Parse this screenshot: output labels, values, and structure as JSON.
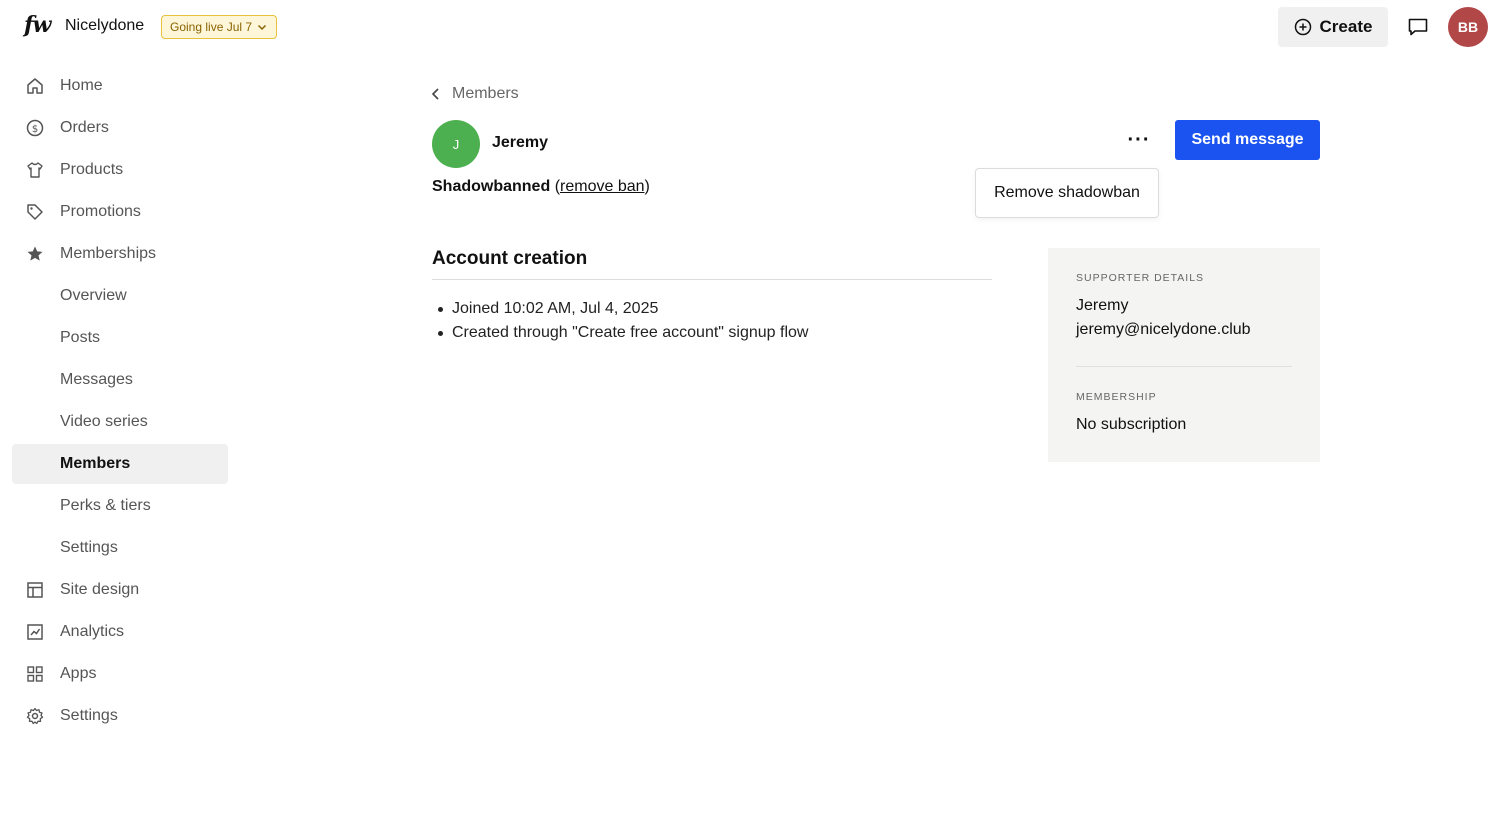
{
  "header": {
    "logo": "fw",
    "site_name": "Nicelydone",
    "live_badge": "Going live Jul 7",
    "create_label": "Create",
    "avatar_initials": "BB"
  },
  "sidebar": {
    "items": [
      {
        "label": "Home",
        "icon": "home-icon"
      },
      {
        "label": "Orders",
        "icon": "dollar-icon"
      },
      {
        "label": "Products",
        "icon": "shirt-icon"
      },
      {
        "label": "Promotions",
        "icon": "tag-icon"
      },
      {
        "label": "Memberships",
        "icon": "star-icon"
      },
      {
        "label": "Overview"
      },
      {
        "label": "Posts"
      },
      {
        "label": "Messages"
      },
      {
        "label": "Video series"
      },
      {
        "label": "Members",
        "active": true
      },
      {
        "label": "Perks & tiers"
      },
      {
        "label": "Settings"
      },
      {
        "label": "Site design",
        "icon": "layout-icon"
      },
      {
        "label": "Analytics",
        "icon": "chart-icon"
      },
      {
        "label": "Apps",
        "icon": "apps-icon"
      },
      {
        "label": "Settings",
        "icon": "gear-icon"
      }
    ]
  },
  "main": {
    "breadcrumb": "Members",
    "member": {
      "initial": "J",
      "name": "Jeremy"
    },
    "more_label": "···",
    "send_label": "Send message",
    "dropdown_item": "Remove shadowban",
    "status": {
      "label": "Shadowbanned",
      "open_paren": "(",
      "link": "remove ban",
      "close_paren": ")"
    },
    "section_title": "Account creation",
    "bullets": [
      "Joined 10:02 AM, Jul 4, 2025",
      "Created through \"Create free account\" signup flow"
    ]
  },
  "card": {
    "supporter_label": "Supporter details",
    "supporter_name": "Jeremy",
    "supporter_email": "jeremy@nicelydone.club",
    "membership_label": "Membership",
    "membership_value": "No subscription"
  },
  "colors": {
    "primary": "#1a53f0",
    "member_avatar": "#4caf50",
    "user_avatar": "#b24747",
    "badge_bg": "#fdf6d8",
    "badge_border": "#e8c23d"
  }
}
